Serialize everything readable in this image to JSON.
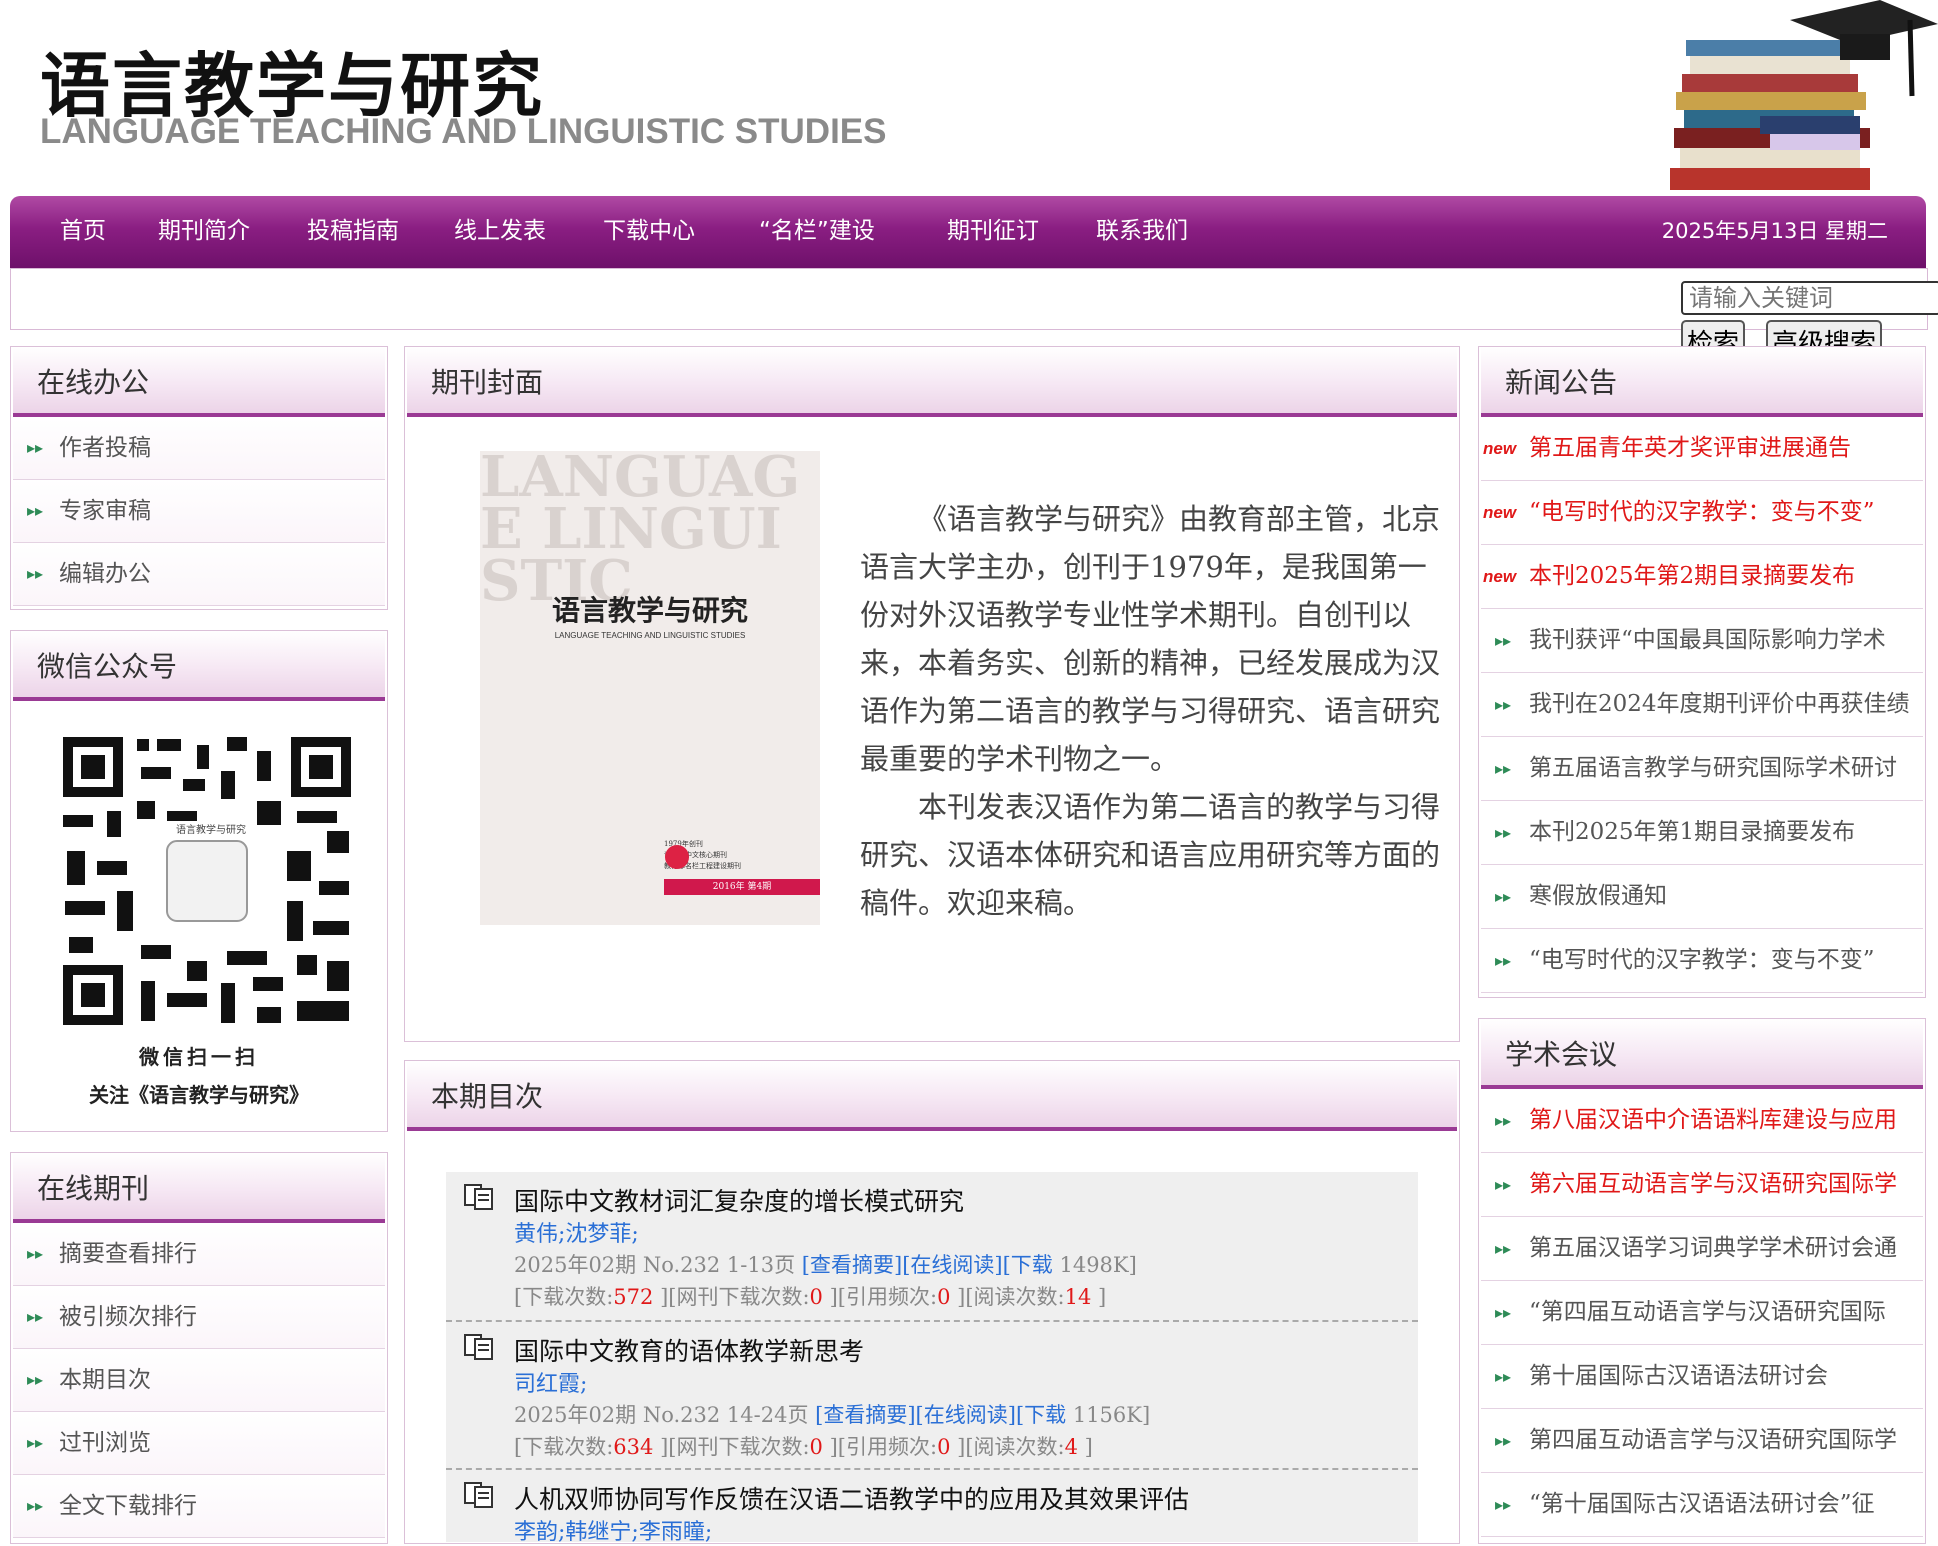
{
  "header": {
    "title_cn": "语言教学与研究",
    "title_en": "LANGUAGE TEACHING AND LINGUISTIC STUDIES"
  },
  "nav": {
    "items": [
      "首页",
      "期刊简介",
      "投稿指南",
      "线上发表",
      "下载中心",
      "“名栏”建设",
      "期刊征订",
      "联系我们"
    ],
    "date": "2025年5月13日  星期二"
  },
  "search": {
    "placeholder": "请输入关键词",
    "search_button": "检索",
    "advanced_button": "高级搜索"
  },
  "online_office": {
    "title": "在线办公",
    "items": [
      "作者投稿",
      "专家审稿",
      "编辑办公"
    ]
  },
  "wechat": {
    "title": "微信公众号",
    "scan_text": "微信扫一扫",
    "follow_text": "关注《语言教学与研究》"
  },
  "online_journal": {
    "title": "在线期刊",
    "items": [
      "摘要查看排行",
      "被引频次排行",
      "本期目次",
      "过刊浏览",
      "全文下载排行"
    ]
  },
  "cover": {
    "title": "期刊封面",
    "cover_title": "语言教学与研究",
    "cover_subtitle": "LANGUAGE TEACHING AND LINGUISTIC STUDIES",
    "cover_bg_text": "LANGUAGE LINGUISTIC",
    "cover_issue": "2016年 第4期",
    "cover_small_1": "1979年创刊",
    "cover_small_2": "语言学中文核心期刊",
    "cover_small_3": "教育部名栏工程建设期刊",
    "intro_1": "《语言教学与研究》由教育部主管，北京语言大学主办，创刊于1979年，是我国第一份对外汉语教学专业性学术期刊。自创刊以来，本着务实、创新的精神，已经发展成为汉语作为第二语言的教学与习得研究、语言研究最重要的学术刊物之一。",
    "intro_2": "本刊发表汉语作为第二语言的教学与习得研究、汉语本体研究和语言应用研究等方面的稿件。欢迎来稿。"
  },
  "toc": {
    "title": "本期目次",
    "labels": {
      "view_abstract": "[查看摘要]",
      "read_online": "[在线阅读]",
      "download": "[下载",
      "downloads": "[下载次数:",
      "net_downloads": "][网刊下载次数:",
      "citations": "][引用频次:",
      "reads": "][阅读次数:",
      "close": "]"
    },
    "entries": [
      {
        "title": "国际中文教材词汇复杂度的增长模式研究",
        "authors": "黄伟;沈梦菲;",
        "issue": "2025年02期 No.232 1-13页",
        "size": "1498K]",
        "downloads": "572",
        "net_downloads": "0",
        "citations": "0",
        "reads": "14"
      },
      {
        "title": "国际中文教育的语体教学新思考",
        "authors": "司红霞;",
        "issue": "2025年02期 No.232 14-24页",
        "size": "1156K]",
        "downloads": "634",
        "net_downloads": "0",
        "citations": "0",
        "reads": "4"
      },
      {
        "title": "人机双师协同写作反馈在汉语二语教学中的应用及其效果评估",
        "authors": "李韵;韩继宁;李雨瞳;"
      }
    ]
  },
  "news": {
    "title": "新闻公告",
    "new_tag": "new",
    "items": [
      {
        "text": "第五届青年英才奖评审进展通告",
        "hot": true
      },
      {
        "text": "“电写时代的汉字教学：变与不变”",
        "hot": true
      },
      {
        "text": "本刊2025年第2期目录摘要发布",
        "hot": true
      },
      {
        "text": "我刊获评“中国最具国际影响力学术",
        "hot": false
      },
      {
        "text": "我刊在2024年度期刊评价中再获佳绩",
        "hot": false
      },
      {
        "text": "第五届语言教学与研究国际学术研讨",
        "hot": false
      },
      {
        "text": "本刊2025年第1期目录摘要发布",
        "hot": false
      },
      {
        "text": "寒假放假通知",
        "hot": false
      },
      {
        "text": "“电写时代的汉字教学：变与不变”",
        "hot": false
      }
    ]
  },
  "conference": {
    "title": "学术会议",
    "items": [
      {
        "text": "第八届汉语中介语语料库建设与应用",
        "hot": true
      },
      {
        "text": "第六届互动语言学与汉语研究国际学",
        "hot": true
      },
      {
        "text": "第五届汉语学习词典学学术研讨会通",
        "hot": false
      },
      {
        "text": "“第四届互动语言学与汉语研究国际",
        "hot": false
      },
      {
        "text": "第十届国际古汉语语法研讨会",
        "hot": false
      },
      {
        "text": "第四届互动语言学与汉语研究国际学",
        "hot": false
      },
      {
        "text": "“第十届国际古汉语语法研讨会”征",
        "hot": false
      }
    ]
  },
  "colors": {
    "nav_purple": "#8a1e82",
    "accent_red": "#e01818",
    "link_blue": "#2a6fd6"
  }
}
